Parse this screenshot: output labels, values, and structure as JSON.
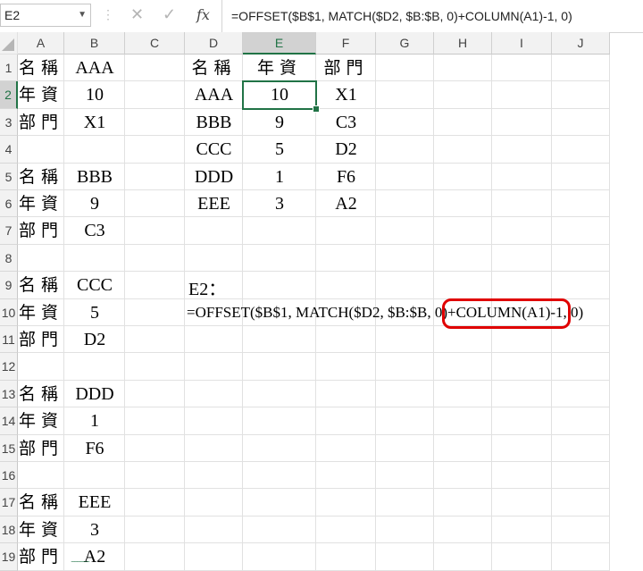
{
  "name_box": {
    "value": "E2"
  },
  "formula_bar": {
    "formula": "=OFFSET($B$1, MATCH($D2, $B:$B, 0)+COLUMN(A1)-1, 0)"
  },
  "icons": {
    "fx_label": "fx",
    "cancel": "close-icon",
    "enter": "check-icon"
  },
  "columns": [
    "A",
    "B",
    "C",
    "D",
    "E",
    "F",
    "G",
    "H",
    "I",
    "J"
  ],
  "rows": [
    "1",
    "2",
    "3",
    "4",
    "5",
    "6",
    "7",
    "8",
    "9",
    "10",
    "11",
    "12",
    "13",
    "14",
    "15",
    "16",
    "17",
    "18",
    "19"
  ],
  "active_cell": "E2",
  "accent_color": "#217346",
  "highlight_color": "#e00000",
  "cells": [
    {
      "ref": "A1",
      "v": "名稱"
    },
    {
      "ref": "B1",
      "v": "AAA"
    },
    {
      "ref": "A2",
      "v": "年資"
    },
    {
      "ref": "B2",
      "v": "10"
    },
    {
      "ref": "A3",
      "v": "部門"
    },
    {
      "ref": "B3",
      "v": "X1"
    },
    {
      "ref": "A5",
      "v": "名稱"
    },
    {
      "ref": "B5",
      "v": "BBB"
    },
    {
      "ref": "A6",
      "v": "年資"
    },
    {
      "ref": "B6",
      "v": "9"
    },
    {
      "ref": "A7",
      "v": "部門"
    },
    {
      "ref": "B7",
      "v": "C3"
    },
    {
      "ref": "A9",
      "v": "名稱"
    },
    {
      "ref": "B9",
      "v": "CCC"
    },
    {
      "ref": "A10",
      "v": "年資"
    },
    {
      "ref": "B10",
      "v": "5"
    },
    {
      "ref": "A11",
      "v": "部門"
    },
    {
      "ref": "B11",
      "v": "D2"
    },
    {
      "ref": "A13",
      "v": "名稱"
    },
    {
      "ref": "B13",
      "v": "DDD"
    },
    {
      "ref": "A14",
      "v": "年資"
    },
    {
      "ref": "B14",
      "v": "1"
    },
    {
      "ref": "A15",
      "v": "部門"
    },
    {
      "ref": "B15",
      "v": "F6"
    },
    {
      "ref": "A17",
      "v": "名稱"
    },
    {
      "ref": "B17",
      "v": "EEE"
    },
    {
      "ref": "A18",
      "v": "年資"
    },
    {
      "ref": "B18",
      "v": "3"
    },
    {
      "ref": "A19",
      "v": "部門"
    },
    {
      "ref": "B19",
      "v": "A2"
    },
    {
      "ref": "D1",
      "v": "名稱"
    },
    {
      "ref": "E1",
      "v": "年資"
    },
    {
      "ref": "F1",
      "v": "部門"
    },
    {
      "ref": "D2",
      "v": "AAA"
    },
    {
      "ref": "E2",
      "v": "10"
    },
    {
      "ref": "F2",
      "v": "X1"
    },
    {
      "ref": "D3",
      "v": "BBB"
    },
    {
      "ref": "E3",
      "v": "9"
    },
    {
      "ref": "F3",
      "v": "C3"
    },
    {
      "ref": "D4",
      "v": "CCC"
    },
    {
      "ref": "E4",
      "v": "5"
    },
    {
      "ref": "F4",
      "v": "D2"
    },
    {
      "ref": "D5",
      "v": "DDD"
    },
    {
      "ref": "E5",
      "v": "1"
    },
    {
      "ref": "F5",
      "v": "F6"
    },
    {
      "ref": "D6",
      "v": "EEE"
    },
    {
      "ref": "E6",
      "v": "3"
    },
    {
      "ref": "F6",
      "v": "A2"
    }
  ],
  "note": {
    "title": "E2：",
    "formula_text": "=OFFSET($B$1, MATCH($D2, $B:$B, 0)+COLUMN(A1)-1, 0)",
    "highlighted_part": "+COLUMN(A1)-1"
  }
}
